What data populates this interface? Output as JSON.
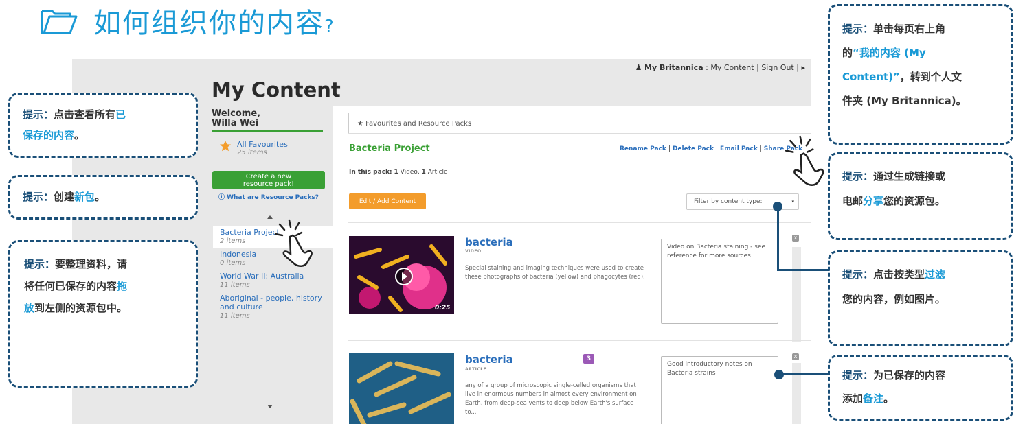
{
  "heading": {
    "title": "如何组织你的内容",
    "question_mark": "?"
  },
  "topbar": {
    "account": "My Britannica",
    "colon": ":",
    "my_content": "My Content",
    "sep1": "|",
    "sign_out": "Sign Out",
    "sep2": "|",
    "arrow": "▸"
  },
  "page_title": "My Content",
  "sidebar": {
    "welcome_line1": "Welcome,",
    "welcome_line2": "Willa Wei",
    "favourites": {
      "label": "All Favourites",
      "count": "25 items"
    },
    "create_line1": "Create a new",
    "create_line2": "resource pack!",
    "what_are": "ⓘ What are Resource Packs?",
    "packs": [
      {
        "name": "Bacteria Project",
        "count": "2 items"
      },
      {
        "name": "Indonesia",
        "count": "0 items"
      },
      {
        "name": "World War II: Australia",
        "count": "11 items"
      },
      {
        "name": "Aboriginal - people, history and culture",
        "count": "11 items"
      }
    ]
  },
  "main": {
    "tab_label": "★ Favourites and Resource Packs",
    "pack_title": "Bacteria Project",
    "actions": [
      "Rename Pack",
      "Delete Pack",
      "Email Pack",
      "Share Pack"
    ],
    "action_sep": "|",
    "in_pack_label": "In this pack:",
    "in_pack_video_count": "1",
    "in_pack_video": "Video,",
    "in_pack_article_count": "1",
    "in_pack_article": "Article",
    "edit_button": "Edit / Add Content",
    "filter_placeholder": "Filter by content type:",
    "filter_caret": "▾",
    "items": [
      {
        "title": "bacteria",
        "type": "VIDEO",
        "duration": "0:25",
        "description": "Special staining and imaging techniques were used to create these photographs of bacteria (yellow) and phagocytes (red).",
        "note": "Video on Bacteria staining - see reference for more sources"
      },
      {
        "title": "bacteria",
        "badge": "3",
        "type": "ARTICLE",
        "description": "any of a group of microscopic single-celled organisms that live in enormous numbers in almost every environment on Earth, from deep-sea vents to deep below Earth's surface to...",
        "note": "Good introductory notes on Bacteria strains"
      }
    ],
    "close_symbol": "x"
  },
  "callouts": {
    "saved": {
      "label": "提示：",
      "text1": "点击查看所有",
      "hl1": "已",
      "hl2": "保存的内容",
      "text2": "。"
    },
    "create": {
      "label": "提示：",
      "text1": "创建",
      "hl": "新包",
      "text2": "。"
    },
    "drag": {
      "label": "提示：",
      "line1": "要整理资料，请",
      "line2a": "将任何已保存的内容",
      "hl_a": "拖",
      "hl_b": "放",
      "line3": "到左侧的资源包中。"
    },
    "account": {
      "label": "提示：",
      "line1": "单击每页右上角",
      "line2a": "的",
      "hl_a": "“我的内容 (My",
      "hl_b": "Content)”",
      "line3b": "，转到个人文",
      "line4": "件夹 (My Britannica)。"
    },
    "share": {
      "label": "提示：",
      "line1": "通过生成链接或",
      "line2a": "电邮",
      "hl": "分享",
      "line2b": "您的资源包。"
    },
    "filter": {
      "label": "提示：",
      "line1a": "点击按类型",
      "hl": "过滤",
      "line2": "您的内容，例如图片。"
    },
    "notes": {
      "label": "提示：",
      "line1": "为已保存的内容",
      "line2a": "添加",
      "hl": "备注",
      "line2b": "。"
    }
  },
  "colors": {
    "accent_blue": "#1a9ad6",
    "callout_border": "#1a4f78",
    "link_blue": "#2a6ebb",
    "green": "#3aa035",
    "orange": "#f39c2b",
    "badge_purple": "#9b59b6"
  }
}
